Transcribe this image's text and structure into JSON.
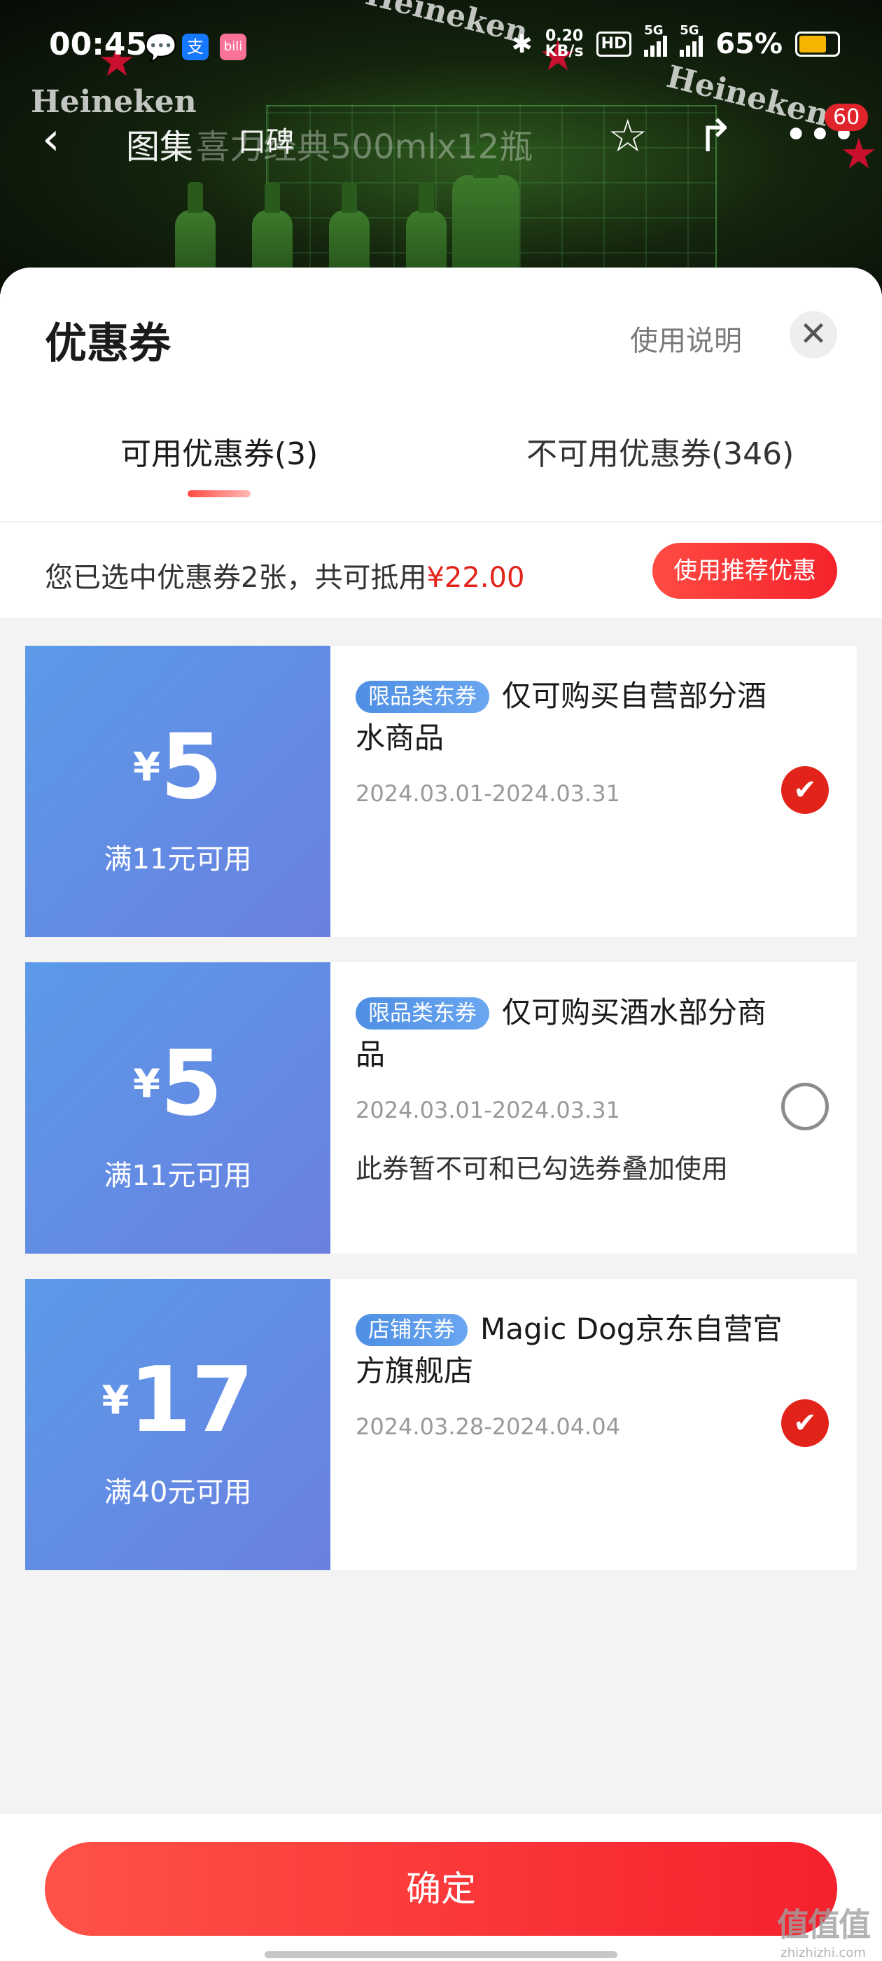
{
  "status_bar": {
    "time": "00:45",
    "net_speed_top": "0.20",
    "net_speed_unit": "KB/s",
    "hd": "HD",
    "sim1": "5G",
    "sim2": "5G",
    "battery_percent": "65%",
    "battery_level": 0.65,
    "app_icons": [
      "message-icon",
      "alipay-icon",
      "bilibili-icon"
    ]
  },
  "product_nav": {
    "tab_gallery": "图集",
    "tab_reviews": "口碑",
    "title_text": "喜力经典500mlx12瓶",
    "cart_count": "60"
  },
  "background_brand": "Heineken",
  "sheet": {
    "title": "优惠券",
    "help_link": "使用说明",
    "close_icon": "close-icon"
  },
  "tabs": [
    {
      "label": "可用优惠券(3)",
      "active": true
    },
    {
      "label": "不可用优惠券(346)",
      "active": false
    }
  ],
  "summary": {
    "text": "您已选中优惠券2张，共可抵用",
    "amount": "¥22.00",
    "recommend_button": "使用推荐优惠"
  },
  "coupons": [
    {
      "currency": "¥",
      "amount": "5",
      "threshold": "满11元可用",
      "badge": "限品类东券",
      "description": "仅可购买自营部分酒水商品",
      "dates": "2024.03.01-2024.03.31",
      "note": "",
      "selected": true
    },
    {
      "currency": "¥",
      "amount": "5",
      "threshold": "满11元可用",
      "badge": "限品类东券",
      "description": "仅可购买酒水部分商品",
      "dates": "2024.03.01-2024.03.31",
      "note": "此券暂不可和已勾选券叠加使用",
      "selected": false
    },
    {
      "currency": "¥",
      "amount": "17",
      "threshold": "满40元可用",
      "badge": "店铺东券",
      "description": "Magic Dog京东自营官方旗舰店",
      "dates": "2024.03.28-2024.04.04",
      "note": "",
      "selected": true
    }
  ],
  "footer": {
    "confirm_button": "确定"
  },
  "watermark": {
    "main": "值值值",
    "sub": "zhizhizhi.com"
  },
  "colors": {
    "accent_red": "#e2231a",
    "coupon_blue": "#5b9ae8",
    "badge_blue": "#4e8fe4"
  }
}
